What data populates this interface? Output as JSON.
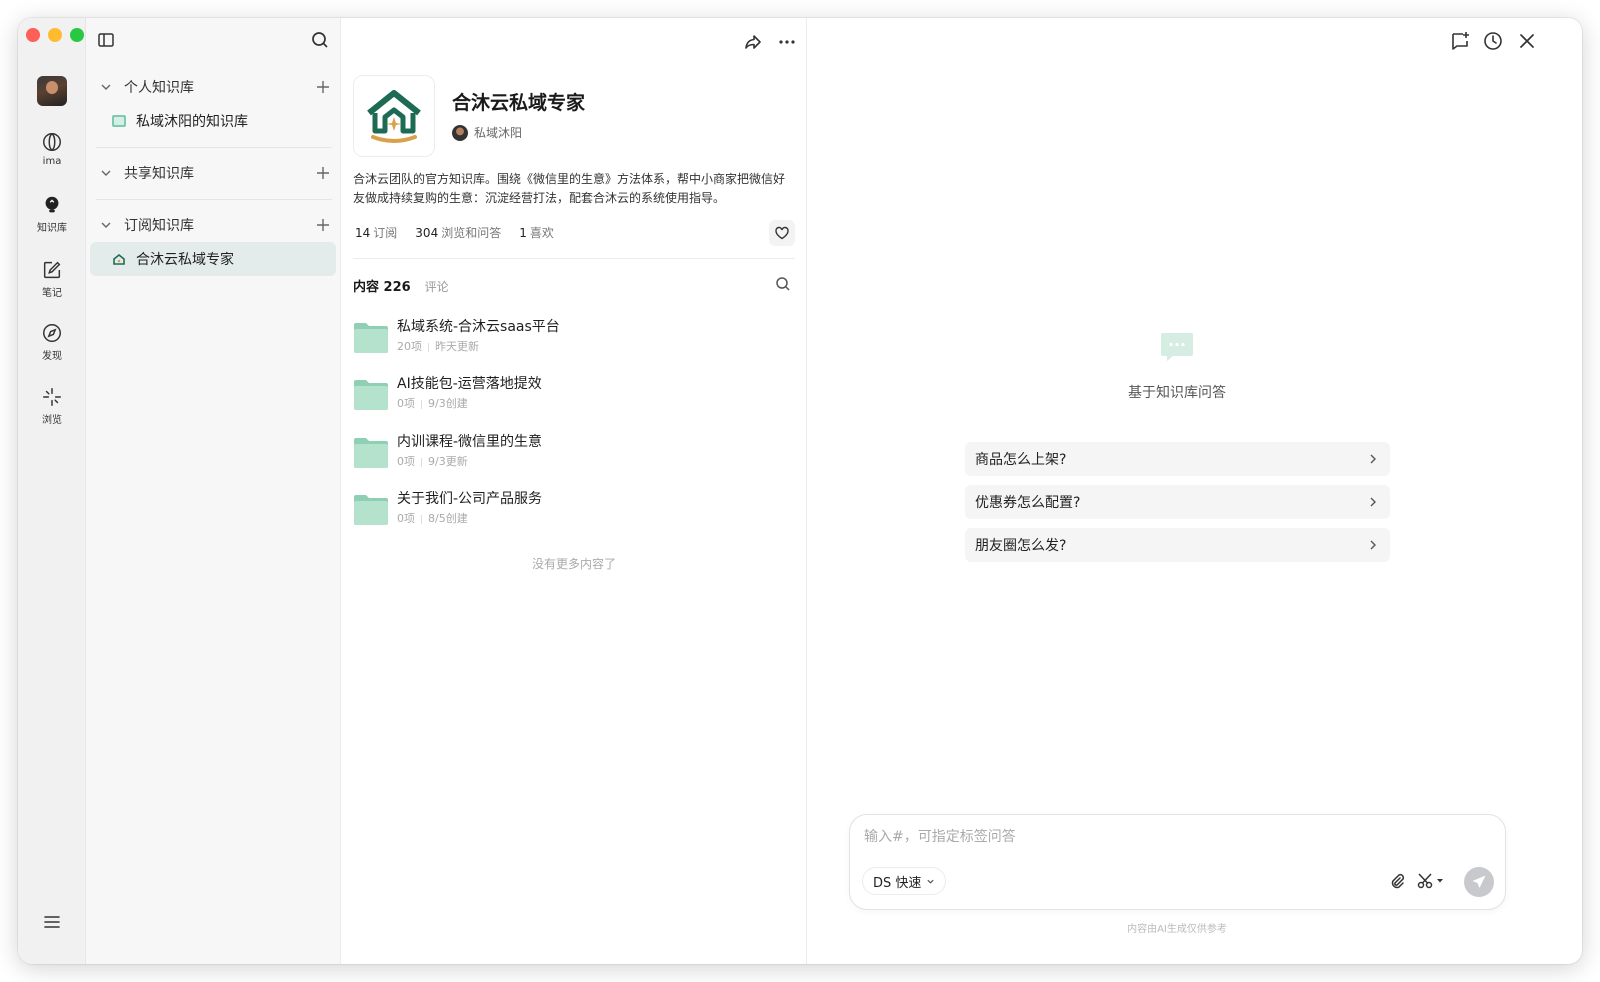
{
  "rail": {
    "items": [
      {
        "label": "ima",
        "icon": "ima-logo-icon"
      },
      {
        "label": "知识库",
        "icon": "knowledge-bulb-icon"
      },
      {
        "label": "笔记",
        "icon": "note-edit-icon"
      },
      {
        "label": "发现",
        "icon": "compass-icon"
      },
      {
        "label": "浏览",
        "icon": "sparkle-icon"
      }
    ]
  },
  "sidebar": {
    "personal": {
      "title": "个人知识库",
      "items": [
        {
          "label": "私域沐阳的知识库"
        }
      ]
    },
    "shared": {
      "title": "共享知识库"
    },
    "subscribed": {
      "title": "订阅知识库",
      "items": [
        {
          "label": "合沐云私域专家"
        }
      ]
    }
  },
  "kb": {
    "title": "合沐云私域专家",
    "author": "私域沐阳",
    "description": "合沐云团队的官方知识库。围绕《微信里的生意》方法体系，帮中小商家把微信好友做成持续复购的生意：沉淀经营打法，配套合沐云的系统使用指导。",
    "stats": [
      {
        "num": "14",
        "label": "订阅"
      },
      {
        "num": "304",
        "label": "浏览和问答"
      },
      {
        "num": "1",
        "label": "喜欢"
      }
    ],
    "tab_content": "内容 226",
    "tab_comments": "评论",
    "folders": [
      {
        "title": "私域系统-合沐云saas平台",
        "count": "20项",
        "time": "昨天更新"
      },
      {
        "title": "AI技能包-运营落地提效",
        "count": "0项",
        "time": "9/3创建"
      },
      {
        "title": "内训课程-微信里的生意",
        "count": "0项",
        "time": "9/3更新"
      },
      {
        "title": "关于我们-公司产品服务",
        "count": "0项",
        "time": "8/5创建"
      }
    ],
    "no_more": "没有更多内容了"
  },
  "chat": {
    "title": "基于知识库问答",
    "suggestions": [
      "商品怎么上架?",
      "优惠券怎么配置?",
      "朋友圈怎么发?"
    ],
    "input_placeholder": "输入#，可指定标签问答",
    "model": "DS 快速",
    "disclaimer": "内容由AI生成仅供参考"
  },
  "colors": {
    "brand_green": "#1e6b55",
    "accent_gold": "#d9a24a",
    "active_row": "#e3ecea",
    "folder_green": "#a8dcc4"
  }
}
